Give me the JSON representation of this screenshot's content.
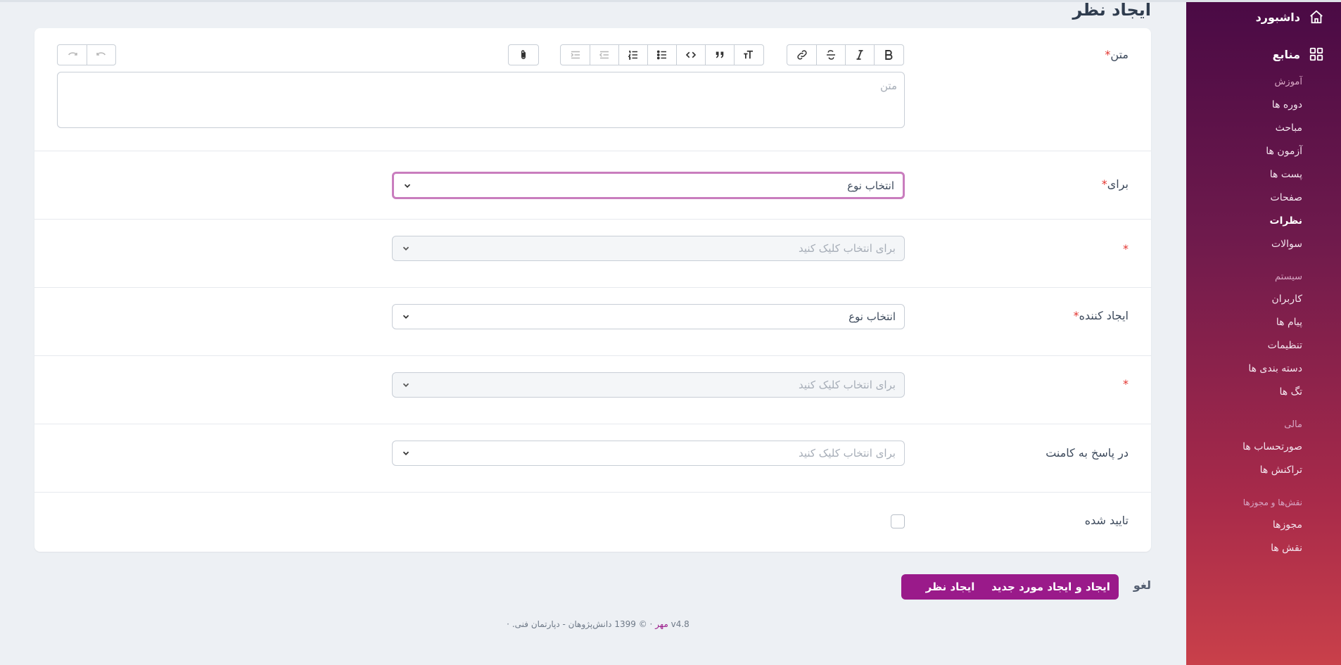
{
  "page": {
    "title": "ایجاد نظر"
  },
  "sidebar": {
    "dashboard": "داشبورد",
    "resources": "منابع",
    "sections": [
      {
        "title": "آموزش",
        "items": [
          "دوره ها",
          "مباحث",
          "آزمون ها",
          "پست ها",
          "صفحات",
          "نظرات",
          "سوالات"
        ]
      },
      {
        "title": "سیستم",
        "items": [
          "کاربران",
          "پیام ها",
          "تنظیمات",
          "دسته بندی ها",
          "تگ ها"
        ]
      },
      {
        "title": "مالی",
        "items": [
          "صورتحساب ها",
          "تراکنش ها"
        ]
      },
      {
        "title": "نقش‌ها و مجوزها",
        "items": [
          "مجوزها",
          "نقش ها"
        ]
      }
    ],
    "active_item": "نظرات"
  },
  "form": {
    "text": {
      "label": "متن",
      "required": "*",
      "placeholder": "متن"
    },
    "for": {
      "label": "برای",
      "required": "*",
      "value": "انتخاب نوع"
    },
    "for_target": {
      "label": "",
      "required": "*",
      "value": "برای انتخاب کلیک کنید"
    },
    "creator": {
      "label": "ایجاد کننده",
      "required": "*",
      "value": "انتخاب نوع"
    },
    "creator_target": {
      "label": "",
      "required": "*",
      "value": "برای انتخاب کلیک کنید"
    },
    "reply_to": {
      "label": "در پاسخ به کامنت",
      "value": "برای انتخاب کلیک کنید"
    },
    "approved": {
      "label": "تایید شده",
      "checked": false
    }
  },
  "toolbar": {
    "format_icons": [
      "bold-icon",
      "italic-icon",
      "strikethrough-icon",
      "link-icon"
    ],
    "block_icons": [
      "heading-icon",
      "quote-icon",
      "code-icon",
      "bullet-list-icon",
      "numbered-list-icon",
      "outdent-icon",
      "indent-icon"
    ],
    "attach_icon": "paperclip-icon",
    "history_icons": [
      "undo-icon",
      "redo-icon"
    ]
  },
  "actions": {
    "create": "ایجاد نظر",
    "create_another": "ایجاد و ایجاد مورد جدید",
    "cancel": "لغو"
  },
  "footer": {
    "brand": "مهر",
    "version": "v4.8",
    "copyright": "© 1399 دانش‌پژوهان - دپارتمان فنی."
  },
  "colors": {
    "accent": "#9a1a8a",
    "sidebar_top": "#4a0a45",
    "sidebar_bottom": "#c9404a",
    "required": "#e3342f"
  }
}
